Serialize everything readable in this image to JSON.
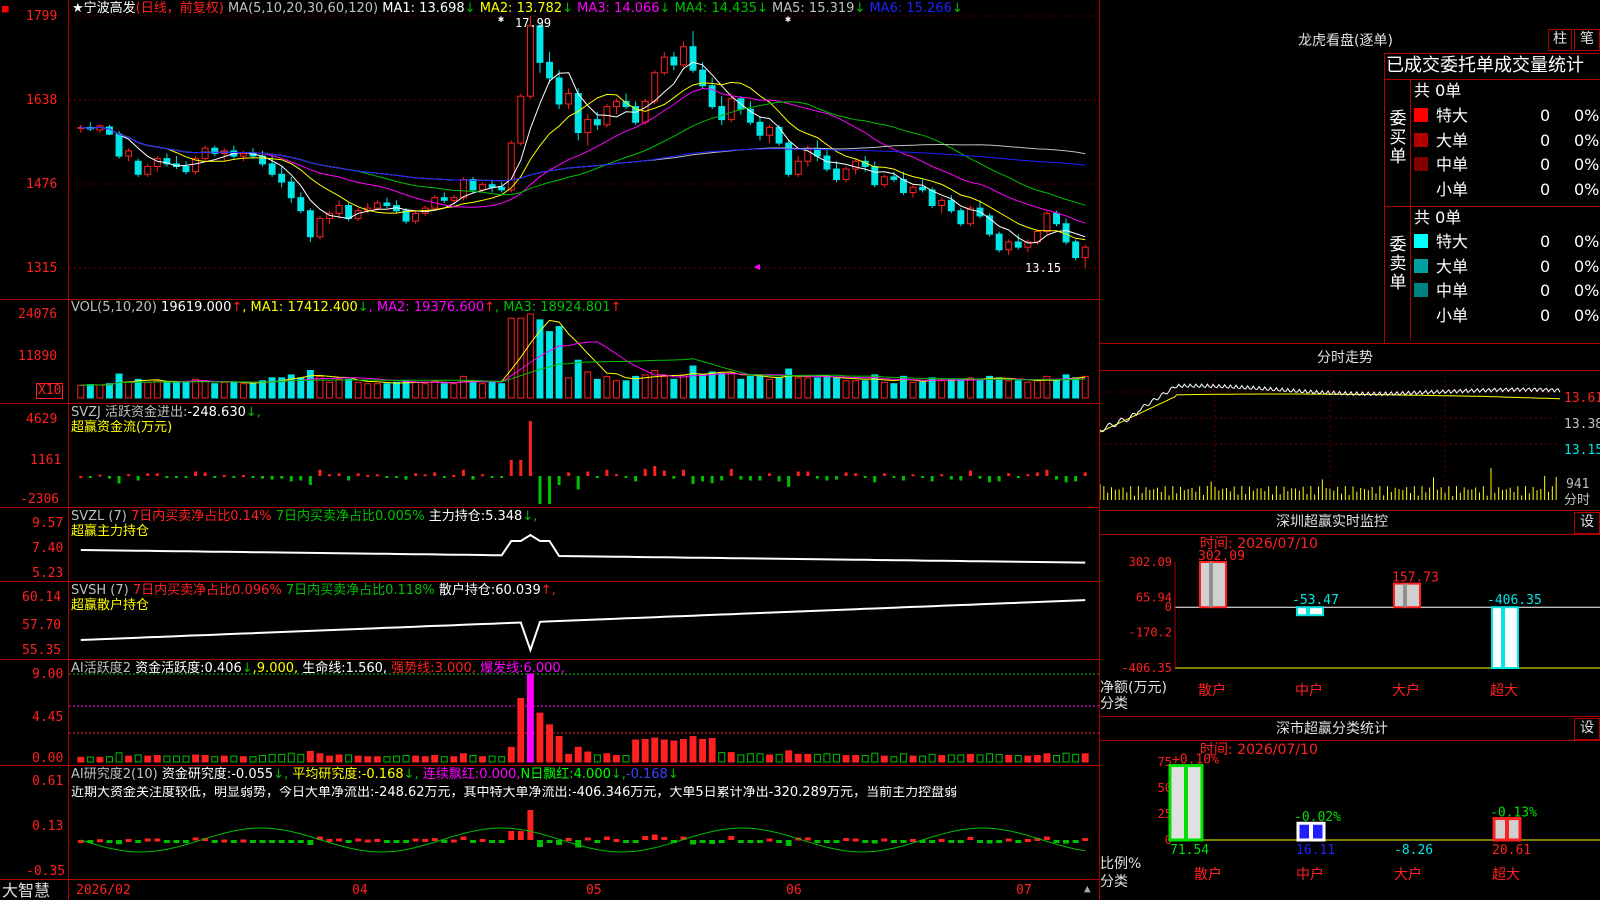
{
  "colors": {
    "up": "#ff2020",
    "down": "#00e5e5",
    "white": "#ffffff",
    "yellow": "#ffff00",
    "magenta": "#ff00ff",
    "green": "#00c000",
    "blue": "#2020ff",
    "grid": "#b00000",
    "gray": "#c0c0c0"
  },
  "main": {
    "title": "★宁波高发",
    "mode": "(日线，前复权)",
    "ma_label": "MA(5,10,20,30,60,120)",
    "ma": [
      {
        "label": "MA1:",
        "value": "13.698",
        "arrow": "↓",
        "color": "#ffffff"
      },
      {
        "label": "MA2:",
        "value": "13.782",
        "arrow": "↓",
        "color": "#ffff00"
      },
      {
        "label": "MA3:",
        "value": "14.066",
        "arrow": "↓",
        "color": "#ff00ff"
      },
      {
        "label": "MA4:",
        "value": "14.435",
        "arrow": "↓",
        "color": "#00c000"
      },
      {
        "label": "MA5:",
        "value": "15.319",
        "arrow": "↓",
        "color": "#c0c0c0"
      },
      {
        "label": "MA6:",
        "value": "15.266",
        "arrow": "↓",
        "color": "#2020ff"
      }
    ],
    "y_ticks": [
      "1799",
      "1638",
      "1476",
      "1315"
    ],
    "high_label": "17.99",
    "low_label": "13.15"
  },
  "vol": {
    "title": "VOL(5,10,20)",
    "value": "19619.000",
    "arrow": "↑",
    "ma": [
      {
        "label": "MA1:",
        "value": "17412.400",
        "arrow": "↓",
        "color": "#ffff00"
      },
      {
        "label": "MA2:",
        "value": "19376.600",
        "arrow": "↑",
        "color": "#ff00ff"
      },
      {
        "label": "MA3:",
        "value": "18924.801",
        "arrow": "↑",
        "color": "#00c000"
      }
    ],
    "y_ticks": [
      "24076",
      "11890"
    ],
    "unit": "X10"
  },
  "svzj": {
    "name": "SVZJ",
    "label": "活跃资金进出:",
    "value": "-248.630",
    "arrow": "↓,",
    "subtitle": "超赢资金流(万元)",
    "y_ticks": [
      "4629",
      "1161",
      "-2306"
    ]
  },
  "svzl": {
    "name": "SVZL (7)",
    "a": "7日内买卖净占比0.14%",
    "b": "7日内买卖净占比0.005%",
    "c": "主力持仓:",
    "value": "5.348",
    "arrow": "↓,",
    "subtitle": "超赢主力持仓",
    "y_ticks": [
      "9.57",
      "7.40",
      "5.23"
    ]
  },
  "svsh": {
    "name": "SVSH (7)",
    "a": "7日内买卖净占比0.096%",
    "b": "7日内买卖净占比0.118%",
    "c": "散户持仓:",
    "value": "60.039",
    "arrow": "↑,",
    "subtitle": "超赢散户持仓",
    "y_ticks": [
      "60.14",
      "57.70",
      "55.35"
    ]
  },
  "ai1": {
    "name": "AI活跃度2",
    "c": "资金活跃度:",
    "value": "0.406",
    "arrow": "↓",
    "v2": ",9.000,",
    "c3": "生命线:",
    "v3": "1.560,",
    "c4": "强势线:",
    "v4": "3.000,",
    "c5": "爆发线:",
    "v5": "6.000,",
    "y_ticks": [
      "9.00",
      "4.45",
      "0.00"
    ]
  },
  "ai2": {
    "name": "AI研究度2(10)",
    "c": "资金研究度:",
    "value": "-0.055",
    "arrow": "↓,",
    "c2": "平均研究度:",
    "v2": "-0.168",
    "a2": "↓,",
    "c3": "连续飘红:",
    "v3": "0.000,",
    "c4": "N日飘红:",
    "v4": "4.000",
    "a4": "↓,",
    "v5": "-0.168",
    "a5": "↓",
    "commentary": "近期大资金关注度较低，明显弱势，今日大单净流出:-248.62万元，其中特大单净流出:-406.346万元，大单5日累计净出-320.289万元，当前主力控盘弱",
    "y_ticks": [
      "0.61",
      "0.13",
      "-0.35"
    ]
  },
  "xaxis": {
    "brand": "大智慧",
    "labels": [
      "2026/02",
      "04",
      "05",
      "06",
      "07"
    ]
  },
  "lhb": {
    "title": "龙虎看盘(逐单)",
    "btn1": "柱",
    "btn2": "笔",
    "subtitle": "已成交委托单成交量统计",
    "buy": {
      "side": "委买单",
      "total": "共 0单",
      "rows": [
        {
          "name": "特大",
          "vol": "0",
          "pct": "0%",
          "color": "#ff0000"
        },
        {
          "name": "大单",
          "vol": "0",
          "pct": "0%",
          "color": "#b00000"
        },
        {
          "name": "中单",
          "vol": "0",
          "pct": "0%",
          "color": "#800000"
        },
        {
          "name": "小单",
          "vol": "0",
          "pct": "0%",
          "color": ""
        }
      ]
    },
    "sell": {
      "side": "委卖单",
      "total": "共 0单",
      "rows": [
        {
          "name": "特大",
          "vol": "0",
          "pct": "0%",
          "color": "#00ffff"
        },
        {
          "name": "大单",
          "vol": "0",
          "pct": "0%",
          "color": "#00a0a0"
        },
        {
          "name": "中单",
          "vol": "0",
          "pct": "0%",
          "color": "#008080"
        },
        {
          "name": "小单",
          "vol": "0",
          "pct": "0%",
          "color": ""
        }
      ]
    }
  },
  "fenshi": {
    "title": "分时走势",
    "y_ticks": [
      "13.61",
      "13.38",
      "13.15"
    ],
    "vol_tick": "941",
    "unit": "分时"
  },
  "monitor": {
    "title": "深圳超赢实时监控",
    "btn": "设",
    "time": "时间: 2026/07/10",
    "y_ticks": [
      "302.09",
      "65.94",
      "0",
      "-170.2",
      "-406.35"
    ],
    "ylabel": "净额(万元)",
    "xlabel": "分类",
    "chart_data": {
      "type": "bar",
      "categories": [
        "散户",
        "中户",
        "大户",
        "超大"
      ],
      "values": [
        302.09,
        -53.47,
        157.73,
        -406.35
      ],
      "value_labels": [
        "302.09",
        "-53.47",
        "157.73",
        "-406.35"
      ],
      "ylim": [
        -406.35,
        302.09
      ],
      "title": "深圳超赢实时监控"
    }
  },
  "stats": {
    "title": "深市超赢分类统计",
    "btn": "设",
    "time": "时间: 2026/07/10",
    "y_ticks": [
      "75",
      "50",
      "25",
      "0"
    ],
    "ylabel": "比例%",
    "xlabel": "分类",
    "chart_data": {
      "type": "bar",
      "categories": [
        "散户",
        "中户",
        "大户",
        "超大"
      ],
      "values": [
        71.54,
        16.11,
        -8.26,
        20.61
      ],
      "top_labels": [
        "+0.10%",
        "-0.02%",
        "",
        "-0.13%"
      ],
      "bottom_labels": [
        "71.54",
        "16.11",
        "-8.26",
        "20.61"
      ],
      "ylim": [
        0,
        75
      ],
      "title": "深市超赢分类统计"
    }
  },
  "chart_data": {
    "type": "candlestick",
    "title": "宁波高发",
    "x": [
      "2026/02",
      "04",
      "05",
      "06",
      "07"
    ],
    "ylim": [
      13.15,
      17.99
    ],
    "series": [
      {
        "name": "MA1",
        "values": [
          13.698
        ]
      },
      {
        "name": "MA2",
        "values": [
          13.782
        ]
      },
      {
        "name": "MA3",
        "values": [
          14.066
        ]
      },
      {
        "name": "MA4",
        "values": [
          14.435
        ]
      },
      {
        "name": "MA5",
        "values": [
          15.319
        ]
      },
      {
        "name": "MA6",
        "values": [
          15.266
        ]
      }
    ],
    "ohlc": [
      [
        15.85,
        15.9,
        15.75,
        15.85
      ],
      [
        15.85,
        15.95,
        15.78,
        15.82
      ],
      [
        15.8,
        15.9,
        15.75,
        15.88
      ],
      [
        15.86,
        15.9,
        15.7,
        15.72
      ],
      [
        15.72,
        15.78,
        15.25,
        15.3
      ],
      [
        15.3,
        15.45,
        15.2,
        15.4
      ],
      [
        15.2,
        15.25,
        14.9,
        14.95
      ],
      [
        14.95,
        15.15,
        14.9,
        15.1
      ],
      [
        15.1,
        15.3,
        15.0,
        15.25
      ],
      [
        15.25,
        15.35,
        15.1,
        15.15
      ],
      [
        15.15,
        15.3,
        15.05,
        15.1
      ],
      [
        15.1,
        15.2,
        14.95,
        15.0
      ],
      [
        15.0,
        15.3,
        14.95,
        15.25
      ],
      [
        15.25,
        15.5,
        15.2,
        15.45
      ],
      [
        15.45,
        15.5,
        15.3,
        15.35
      ],
      [
        15.35,
        15.45,
        15.2,
        15.4
      ],
      [
        15.4,
        15.5,
        15.25,
        15.3
      ],
      [
        15.3,
        15.4,
        15.2,
        15.35
      ],
      [
        15.35,
        15.45,
        15.25,
        15.3
      ],
      [
        15.3,
        15.4,
        15.1,
        15.15
      ],
      [
        15.15,
        15.3,
        14.9,
        14.95
      ],
      [
        14.95,
        15.1,
        14.7,
        14.8
      ],
      [
        14.8,
        14.9,
        14.4,
        14.5
      ],
      [
        14.5,
        14.6,
        14.2,
        14.25
      ],
      [
        14.25,
        14.3,
        13.65,
        13.75
      ],
      [
        13.75,
        14.15,
        13.7,
        14.1
      ],
      [
        14.1,
        14.25,
        14.0,
        14.2
      ],
      [
        14.2,
        14.45,
        14.1,
        14.35
      ],
      [
        14.35,
        14.4,
        14.05,
        14.1
      ],
      [
        14.1,
        14.3,
        14.05,
        14.25
      ],
      [
        14.25,
        14.4,
        14.2,
        14.3
      ],
      [
        14.3,
        14.45,
        14.25,
        14.4
      ],
      [
        14.4,
        14.5,
        14.3,
        14.35
      ],
      [
        14.35,
        14.45,
        14.2,
        14.25
      ],
      [
        14.25,
        14.3,
        14.0,
        14.05
      ],
      [
        14.05,
        14.25,
        14.0,
        14.2
      ],
      [
        14.2,
        14.35,
        14.15,
        14.3
      ],
      [
        14.3,
        14.55,
        14.25,
        14.5
      ],
      [
        14.5,
        14.6,
        14.4,
        14.45
      ],
      [
        14.45,
        14.55,
        14.35,
        14.5
      ],
      [
        14.5,
        14.9,
        14.45,
        14.85
      ],
      [
        14.85,
        14.9,
        14.6,
        14.65
      ],
      [
        14.65,
        14.8,
        14.6,
        14.75
      ],
      [
        14.75,
        14.85,
        14.6,
        14.7
      ],
      [
        14.7,
        14.8,
        14.6,
        14.65
      ],
      [
        14.65,
        15.6,
        14.6,
        15.55
      ],
      [
        15.55,
        16.5,
        15.5,
        16.45
      ],
      [
        16.45,
        17.99,
        16.4,
        17.8
      ],
      [
        17.8,
        17.85,
        16.9,
        17.1
      ],
      [
        17.1,
        17.3,
        16.7,
        16.8
      ],
      [
        16.8,
        16.95,
        16.2,
        16.3
      ],
      [
        16.3,
        16.6,
        16.2,
        16.5
      ],
      [
        16.5,
        16.6,
        15.6,
        15.75
      ],
      [
        15.75,
        16.1,
        15.5,
        16.0
      ],
      [
        16.0,
        16.15,
        15.8,
        15.9
      ],
      [
        15.9,
        16.3,
        15.85,
        16.25
      ],
      [
        16.25,
        16.4,
        16.1,
        16.35
      ],
      [
        16.35,
        16.5,
        16.2,
        16.25
      ],
      [
        16.25,
        16.35,
        15.9,
        15.95
      ],
      [
        15.95,
        16.4,
        15.9,
        16.35
      ],
      [
        16.35,
        16.95,
        16.3,
        16.9
      ],
      [
        16.9,
        17.3,
        16.85,
        17.2
      ],
      [
        17.2,
        17.3,
        16.95,
        17.05
      ],
      [
        17.05,
        17.5,
        17.0,
        17.4
      ],
      [
        17.4,
        17.7,
        16.9,
        16.95
      ],
      [
        16.95,
        17.1,
        16.6,
        16.65
      ],
      [
        16.65,
        16.8,
        16.2,
        16.25
      ],
      [
        16.25,
        16.45,
        15.9,
        16.0
      ],
      [
        16.0,
        16.5,
        15.95,
        16.4
      ],
      [
        16.4,
        16.45,
        16.1,
        16.2
      ],
      [
        16.2,
        16.35,
        15.9,
        15.95
      ],
      [
        15.95,
        16.05,
        15.6,
        15.7
      ],
      [
        15.7,
        15.9,
        15.55,
        15.85
      ],
      [
        15.85,
        15.9,
        15.5,
        15.55
      ],
      [
        15.55,
        15.6,
        14.9,
        14.95
      ],
      [
        14.95,
        15.3,
        14.9,
        15.2
      ],
      [
        15.2,
        15.5,
        15.1,
        15.45
      ],
      [
        15.45,
        15.6,
        15.2,
        15.3
      ],
      [
        15.3,
        15.45,
        15.0,
        15.05
      ],
      [
        15.05,
        15.2,
        14.8,
        14.85
      ],
      [
        14.85,
        15.1,
        14.8,
        15.05
      ],
      [
        15.05,
        15.25,
        14.95,
        15.2
      ],
      [
        15.2,
        15.3,
        15.0,
        15.1
      ],
      [
        15.1,
        15.2,
        14.7,
        14.75
      ],
      [
        14.75,
        14.95,
        14.7,
        14.9
      ],
      [
        14.9,
        15.0,
        14.8,
        14.85
      ],
      [
        14.85,
        15.0,
        14.55,
        14.6
      ],
      [
        14.6,
        14.75,
        14.5,
        14.7
      ],
      [
        14.7,
        14.85,
        14.6,
        14.65
      ],
      [
        14.65,
        14.7,
        14.3,
        14.35
      ],
      [
        14.35,
        14.5,
        14.2,
        14.45
      ],
      [
        14.45,
        14.55,
        14.2,
        14.25
      ],
      [
        14.25,
        14.3,
        13.95,
        14.0
      ],
      [
        14.0,
        14.35,
        13.95,
        14.3
      ],
      [
        14.3,
        14.45,
        14.1,
        14.15
      ],
      [
        14.15,
        14.2,
        13.75,
        13.8
      ],
      [
        13.8,
        13.85,
        13.45,
        13.5
      ],
      [
        13.5,
        13.7,
        13.4,
        13.65
      ],
      [
        13.65,
        13.8,
        13.5,
        13.55
      ],
      [
        13.55,
        13.7,
        13.45,
        13.65
      ],
      [
        13.65,
        13.9,
        13.6,
        13.85
      ],
      [
        13.85,
        14.25,
        13.8,
        14.2
      ],
      [
        14.2,
        14.25,
        13.95,
        14.0
      ],
      [
        14.0,
        14.1,
        13.6,
        13.65
      ],
      [
        13.65,
        13.7,
        13.3,
        13.35
      ],
      [
        13.35,
        13.6,
        13.15,
        13.55
      ]
    ]
  }
}
